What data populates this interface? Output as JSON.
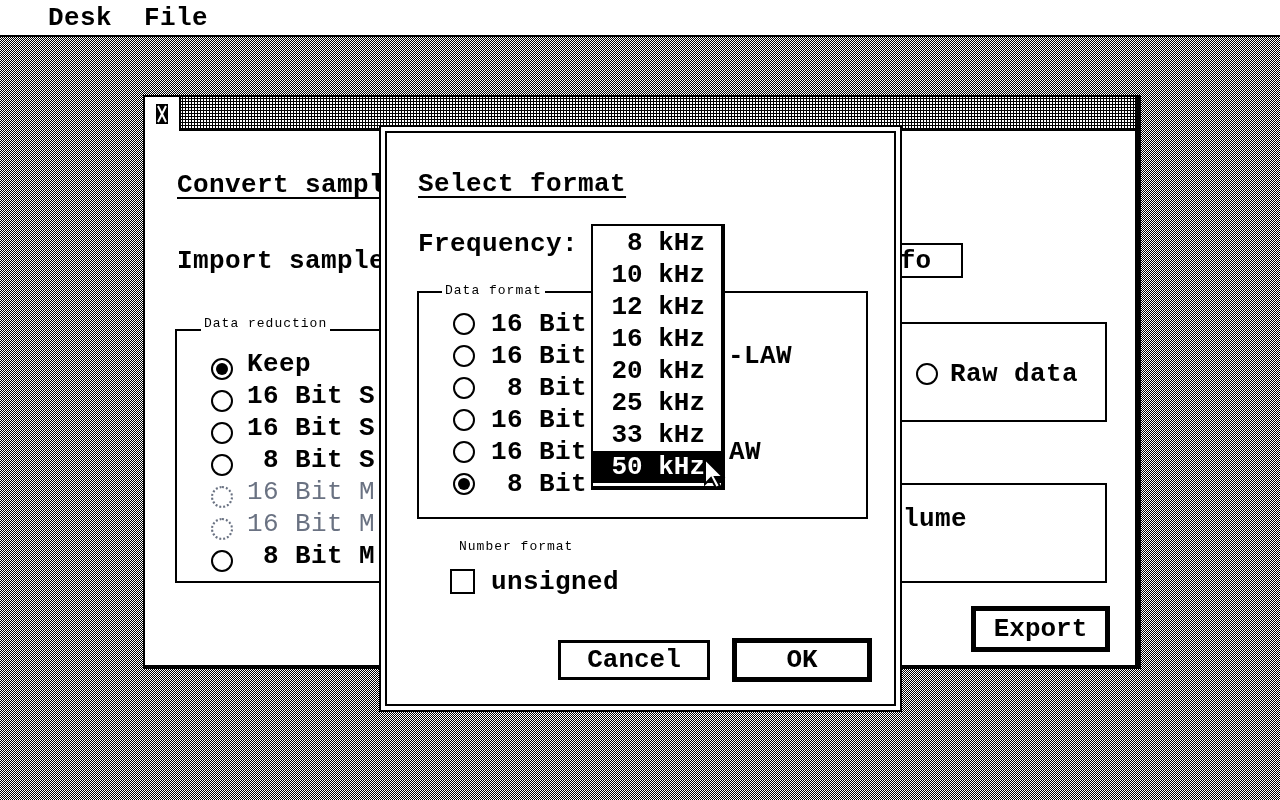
{
  "menu_bar": [
    {
      "label": "Desk"
    },
    {
      "label": "File"
    }
  ],
  "back_window": {
    "heading": "Convert sampl",
    "import_label": "Import sample",
    "field_value": "fo",
    "data_reduction": {
      "label": "Data reduction",
      "options": [
        {
          "label": "Keep",
          "selected": true,
          "disabled": false
        },
        {
          "label": "16 Bit S",
          "selected": false,
          "disabled": false
        },
        {
          "label": "16 Bit S",
          "selected": false,
          "disabled": false
        },
        {
          "label": " 8 Bit S",
          "selected": false,
          "disabled": false
        },
        {
          "label": "16 Bit M",
          "selected": false,
          "disabled": true
        },
        {
          "label": "16 Bit M",
          "selected": false,
          "disabled": true
        },
        {
          "label": " 8 Bit M",
          "selected": false,
          "disabled": false
        }
      ]
    },
    "raw_option": {
      "label": "Raw data",
      "selected": false
    },
    "volume_label": "lume",
    "export_button": "Export"
  },
  "dialog": {
    "title": "Select format",
    "frequency_label": "Frequency:",
    "frequency_menu": [
      {
        "label": "8 kHz",
        "selected": false
      },
      {
        "label": "10 kHz",
        "selected": false
      },
      {
        "label": "12 kHz",
        "selected": false
      },
      {
        "label": "16 kHz",
        "selected": false
      },
      {
        "label": "20 kHz",
        "selected": false
      },
      {
        "label": "25 kHz",
        "selected": false
      },
      {
        "label": "33 kHz",
        "selected": false
      },
      {
        "label": "50 kHz",
        "selected": true
      }
    ],
    "data_format": {
      "label": "Data format",
      "options": [
        {
          "label": "16 Bit",
          "selected": false
        },
        {
          "label": "16 Bit",
          "tail": "-LAW",
          "selected": false
        },
        {
          "label": " 8 Bit",
          "selected": false
        },
        {
          "label": "16 Bit",
          "selected": false
        },
        {
          "label": "16 Bit",
          "tail": "AW",
          "selected": false
        },
        {
          "label": " 8 Bit",
          "selected": true
        }
      ]
    },
    "number_format": {
      "label": "Number format",
      "checkbox": {
        "label": "unsigned",
        "checked": false
      }
    },
    "buttons": [
      {
        "label": "Cancel",
        "default": false
      },
      {
        "label": "OK",
        "default": true
      }
    ]
  }
}
